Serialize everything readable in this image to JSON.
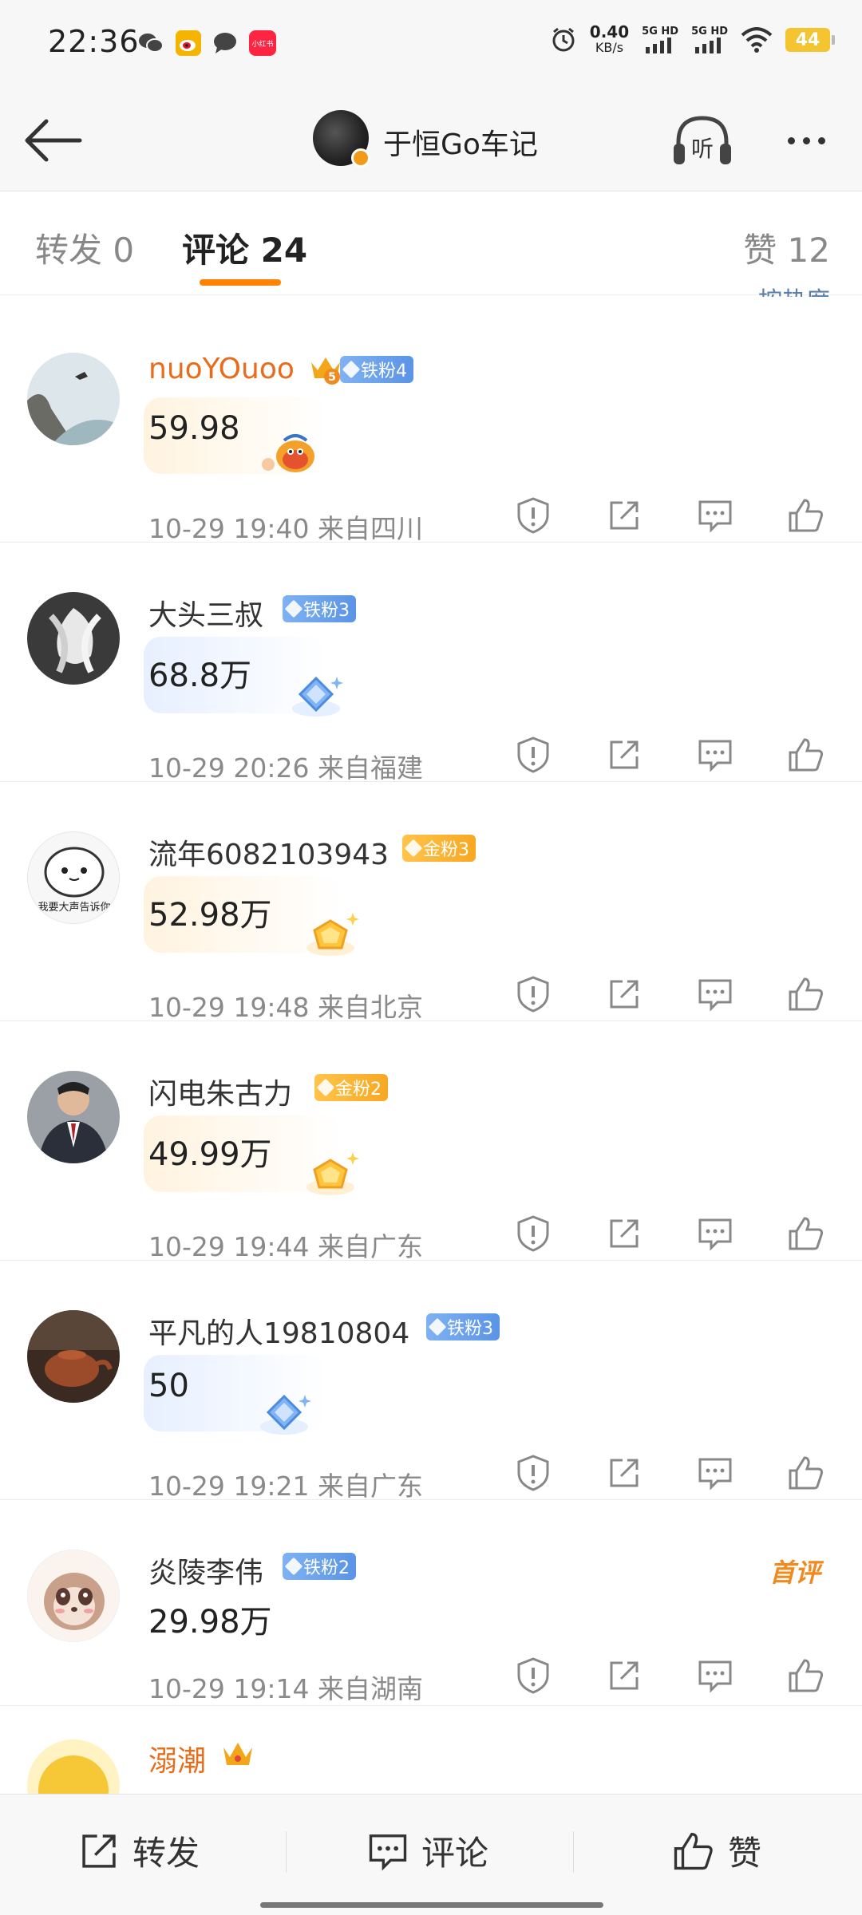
{
  "status_bar": {
    "time": "22:36",
    "speed_value": "0.40",
    "speed_unit": "KB/s",
    "net1": "5G HD",
    "net2": "5G HD",
    "battery": "44",
    "app_icons": [
      "wechat-icon",
      "weibo-icon",
      "message-icon",
      "xiaohongshu-icon"
    ],
    "xiaohongshu_label": "小红书"
  },
  "header": {
    "title": "于恒Go车记",
    "listen_label": "听"
  },
  "tabs": {
    "forward": "转发 0",
    "comment": "评论 24",
    "like": "赞 12"
  },
  "partial_link": "按热度",
  "comments": [
    {
      "name": "nuoYOuoo",
      "crown_level": "5",
      "badge": "铁粉4",
      "badge_type": "iron",
      "text": "59.98",
      "meta": "10-29 19:40  来自四川"
    },
    {
      "name": "大头三叔",
      "badge": "铁粉3",
      "badge_type": "iron",
      "text": "68.8万",
      "meta": "10-29 20:26  来自福建"
    },
    {
      "name": "流年6082103943",
      "badge": "金粉3",
      "badge_type": "gold",
      "text": "52.98万",
      "meta": "10-29 19:48  来自北京",
      "avatar_caption": "我要大声告诉你"
    },
    {
      "name": "闪电朱古力",
      "badge": "金粉2",
      "badge_type": "gold",
      "text": "49.99万",
      "meta": "10-29 19:44  来自广东"
    },
    {
      "name": "平凡的人19810804",
      "badge": "铁粉3",
      "badge_type": "iron",
      "text": "50",
      "meta": "10-29 19:21  来自广东"
    },
    {
      "name": "炎陵李伟",
      "badge": "铁粉2",
      "badge_type": "iron",
      "text": "29.98万",
      "meta": "10-29 19:14  来自湖南",
      "tag": "首评"
    },
    {
      "name": "溺潮"
    }
  ],
  "bottom_bar": {
    "forward": "转发",
    "comment": "评论",
    "like": "赞"
  },
  "colors": {
    "accent": "#ff8200",
    "iron_badge": "#5b94e6",
    "gold_badge": "#f7a823",
    "orange_name": "#e86c1a"
  }
}
